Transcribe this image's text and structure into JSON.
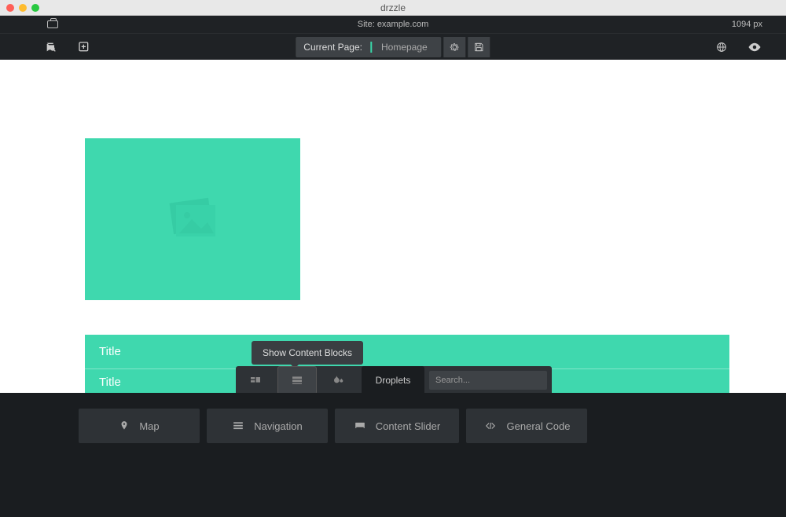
{
  "window": {
    "title": "drzzle"
  },
  "sitebar": {
    "label": "Site: example.com",
    "viewport": "1094 px"
  },
  "toolbar": {
    "current_page_label": "Current Page:",
    "current_page_value": "Homepage"
  },
  "content": {
    "title1": "Title",
    "title2": "Title"
  },
  "panel": {
    "tooltip": "Show Content Blocks",
    "active_tab": "Droplets",
    "search_placeholder": "Search..."
  },
  "blocks": [
    {
      "icon": "map-pin",
      "label": "Map"
    },
    {
      "icon": "menu",
      "label": "Navigation"
    },
    {
      "icon": "slider",
      "label": "Content Slider"
    },
    {
      "icon": "code",
      "label": "General Code"
    }
  ]
}
